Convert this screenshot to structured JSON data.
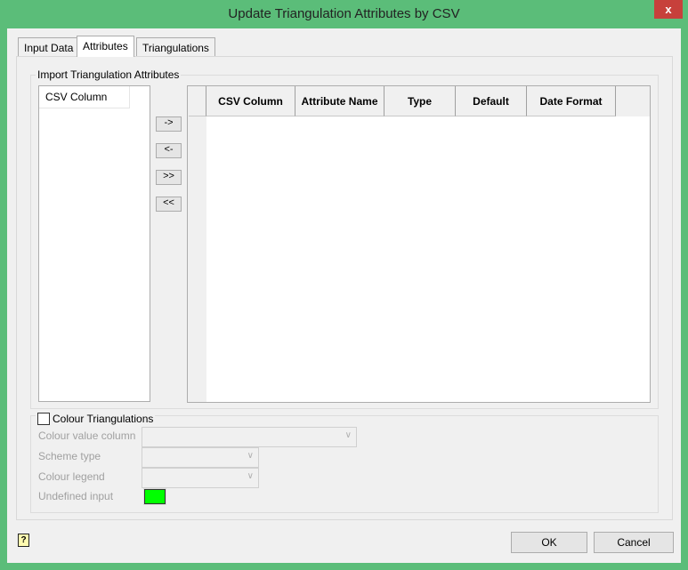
{
  "window": {
    "title": "Update Triangulation Attributes by CSV",
    "close": "x"
  },
  "tabs": [
    {
      "label": "Input Data"
    },
    {
      "label": "Attributes"
    },
    {
      "label": "Triangulations"
    }
  ],
  "import_group": {
    "title": "Import Triangulation Attributes",
    "list_header": "CSV Column",
    "buttons": {
      "add": "->",
      "remove": "<-",
      "add_all": ">>",
      "remove_all": "<<"
    },
    "columns": [
      "CSV Column",
      "Attribute Name",
      "Type",
      "Default",
      "Date Format"
    ]
  },
  "colour_group": {
    "title": "Colour Triangulations",
    "checked": false,
    "colour_value_column": "Colour value column",
    "scheme_type": "Scheme type",
    "colour_legend": "Colour legend",
    "undefined_input": "Undefined input",
    "undefined_color": "#00ff00"
  },
  "footer": {
    "ok": "OK",
    "cancel": "Cancel",
    "help": "?"
  }
}
